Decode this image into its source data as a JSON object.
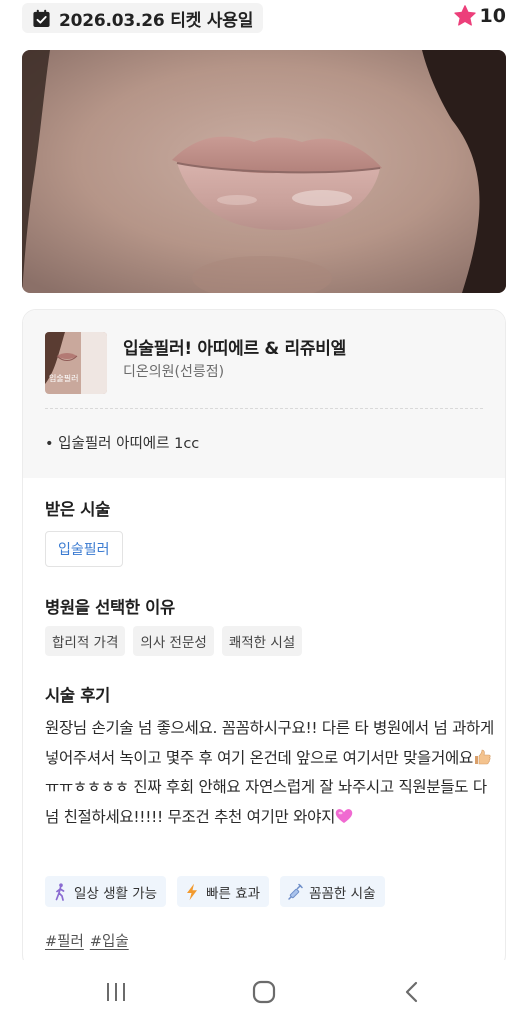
{
  "header": {
    "date_label": "2026.03.26 티켓 사용일",
    "calendar_icon": "calendar-check-icon",
    "star_icon": "star-icon",
    "star_color": "#ec3f7a",
    "star_count": "10"
  },
  "product": {
    "title": "입술필러! 아띠에르 & 리쥬비엘",
    "clinic": "디온의원(선릉점)",
    "thumbnail_caption": "입술필러",
    "option": "• 입술필러 아띠에르 1cc"
  },
  "procedure": {
    "heading": "받은 시술",
    "chip": "입술필러"
  },
  "reasons": {
    "heading": "병원을 선택한 이유",
    "items": [
      "합리적 가격",
      "의사 전문성",
      "쾌적한 시설"
    ]
  },
  "review": {
    "heading": "시술 후기",
    "part1": "원장님 손기술 넘 좋으세요. 꼼꼼하시구요!! 다른 타 병원에서 넘 과하게 넣어주셔서 녹이고 몇주 후 여기 온건데 앞으로 여기서만 맞을거에요",
    "part2": " ㅠㅠㅎㅎㅎㅎ 진짜 후회 안해요 자연스럽게 잘 놔주시고 직원분들도 다 넘 친절하세요!!!!! 무조건 추천 여기만 와야지"
  },
  "effects": [
    {
      "icon": "walking-person-icon",
      "label": "일상 생활 가능"
    },
    {
      "icon": "lightning-icon",
      "label": "빠른 효과"
    },
    {
      "icon": "syringe-icon",
      "label": "꼼꼼한 시술"
    }
  ],
  "hashtags": [
    "#필러",
    "#입술"
  ],
  "colors": {
    "accent_blue": "#3b7bd1",
    "effect_chip_bg": "#eff5fc",
    "card_top_bg": "#f7f7f7"
  },
  "navigation": {
    "recent_apps_icon": "recent-apps-icon",
    "home_icon": "home-icon",
    "back_icon": "back-icon"
  }
}
